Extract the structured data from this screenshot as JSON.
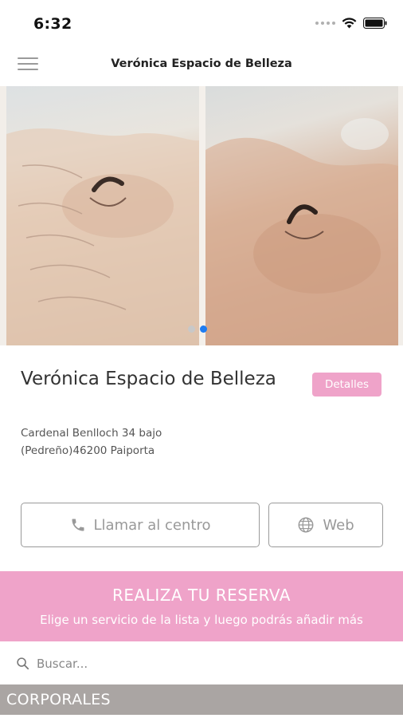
{
  "status_bar": {
    "time": "6:32"
  },
  "header": {
    "title": "Verónica Espacio de Belleza",
    "menu_icon": "hamburger-menu-icon"
  },
  "carousel": {
    "image_count": 2,
    "active_index": 1,
    "dot_active_color": "#1e7cf2",
    "dot_inactive_color": "#c8c8c8"
  },
  "business": {
    "name": "Verónica Espacio de Belleza",
    "details_label": "Detalles",
    "address_line1": "Cardenal Benlloch 34 bajo",
    "address_line2": "(Pedreño)46200 Paiporta"
  },
  "actions": {
    "call_label": "Llamar al centro",
    "call_icon": "phone-icon",
    "web_label": "Web",
    "web_icon": "globe-icon"
  },
  "booking": {
    "title": "REALIZA TU RESERVA",
    "subtitle": "Elige un servicio de la lista y luego podrás añadir más"
  },
  "search": {
    "placeholder": "Buscar...",
    "value": ""
  },
  "categories": [
    {
      "label": "CORPORALES"
    }
  ],
  "colors": {
    "accent_pink": "#efa3c9",
    "category_gray": "#aaa5a3",
    "border_gray": "#9a9a9a"
  }
}
